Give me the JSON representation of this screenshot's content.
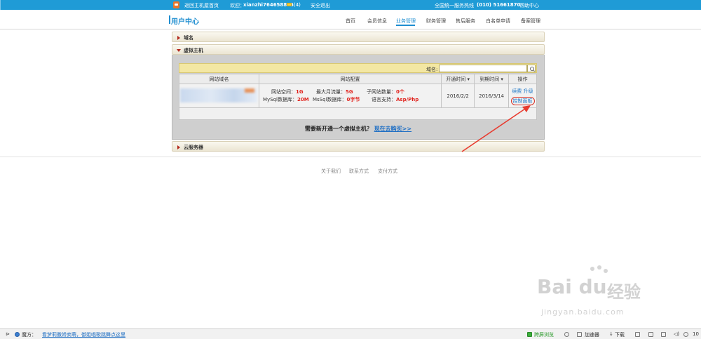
{
  "topbar": {
    "back_link": "返回主机屋首页",
    "welcome": "欢迎：",
    "username": "xianzhi764658875",
    "mail_count": "(4)",
    "logout": "安全退出",
    "hotline": "全国统一服务热线",
    "hotline_number": "(010) 51661870",
    "help": "帮助中心"
  },
  "header": {
    "brand": "用户中心",
    "nav": [
      "首页",
      "会员信息",
      "业务管理",
      "财务管理",
      "售后服务",
      "白名单申请",
      "备案管理"
    ]
  },
  "panels": {
    "domain": "域名",
    "vhost": "虚拟主机",
    "cloud": "云服务器"
  },
  "vhost": {
    "search_label": "域名:",
    "columns": {
      "site_domain": "网站域名",
      "site_config": "网站配置",
      "open_time": "开通时间",
      "expire_time": "到期时间",
      "ops": "操作"
    },
    "row": {
      "config": {
        "space_label": "网站空间：",
        "space_value": "1G",
        "traffic_label": "最大月流量：",
        "traffic_value": "5G",
        "subsite_label": "子网站数量：",
        "subsite_value": "0个",
        "mysql_label": "MySql数据库：",
        "mysql_value": "20M",
        "mssql_label": "MsSql数据库：",
        "mssql_value": "0字节",
        "lang_label": "语言支持：",
        "lang_value": "Asp/Php"
      },
      "open_time": "2016/2/2",
      "expire_time": "2016/3/14",
      "renew": "续费",
      "upgrade": "升级",
      "manage": "控制面板"
    },
    "promo_text": "需要新开通一个虚拟主机？",
    "promo_link": "现在去购买>>"
  },
  "footer": {
    "links": [
      "关于我们",
      "联系方式",
      "支付方式"
    ]
  },
  "watermark": {
    "logo": "Bai du",
    "cn": "经验",
    "url": "jingyan.baidu.com"
  },
  "statusbar": {
    "magic_label": "魔方：",
    "news_link": "看梦莉撒娇卖萌，御姐唱歌跳舞点这里",
    "cross_screen": "跨屏浏览",
    "accelerator": "加速器",
    "download": "下载",
    "zoom": "10"
  },
  "colors": {
    "brand_blue": "#1f9bd6",
    "highlight_red": "#e0211b",
    "search_yellow": "#f3e7a3"
  }
}
